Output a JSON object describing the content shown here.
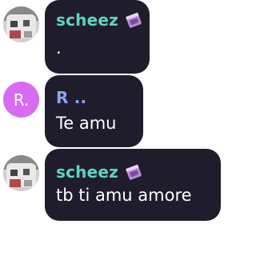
{
  "messages": [
    {
      "author": "scheez",
      "author_color": "#5fd4c4",
      "avatar_type": "photo",
      "badge_icon": "gem-book-icon",
      "text": "."
    },
    {
      "author": "R ..",
      "author_color": "#8fa3f0",
      "avatar_type": "letter",
      "avatar_letter": "R.",
      "avatar_color": "#d76cf0",
      "text": "Te amu"
    },
    {
      "author": "scheez",
      "author_color": "#5fd4c4",
      "avatar_type": "photo",
      "badge_icon": "gem-book-icon",
      "text": "tb ti amu amore"
    }
  ]
}
